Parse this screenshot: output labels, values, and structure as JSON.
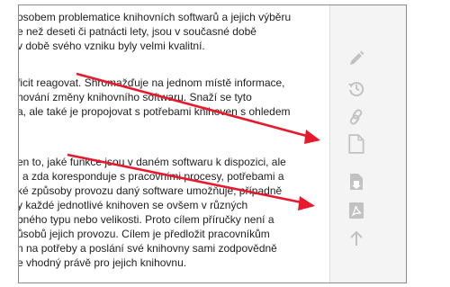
{
  "content": {
    "paragraphs": [
      {
        "lines": [
          "osobem problematice knihovních softwarů a jejich výběru",
          "e než deseti či patnácti lety, jsou v současné době",
          "v době svého vzniku byly velmi kvalitní."
        ]
      },
      {
        "lines": [
          "ficit reagovat. Shromažďuje na jednom místě informace,",
          "nování změny knihovního softwaru. Snaží se tyto",
          "a, ale také je propojovat s potřebami knihoven s ohledem"
        ]
      },
      {
        "lines": [
          "en to, jaké funkce jsou v daném softwaru k dispozici, ale",
          "i a zda koresponduje s pracovními procesy, potřebami a",
          "ké způsoby provozu daný software umožňuje, případně",
          "y každé jednotlivé knihoven se ovšem v různých",
          "bného typu nebo velikosti. Proto cílem příručky není a",
          "ůsobů jejich provozu. Cílem je předložit pracovníkům",
          "n na potřeby a poslání své knihovny sami zodpovědně",
          "e vhodný právě pro jejich knihovnu."
        ]
      }
    ]
  },
  "toolbar": {
    "icons": [
      "pencil-icon",
      "history-icon",
      "link-icon",
      "blank-page-icon",
      "save-file-icon",
      "pdf-icon",
      "arrow-up-icon"
    ],
    "icon_color": "#c2c2c2"
  },
  "annotation": {
    "arrow_color": "#e8192c"
  }
}
